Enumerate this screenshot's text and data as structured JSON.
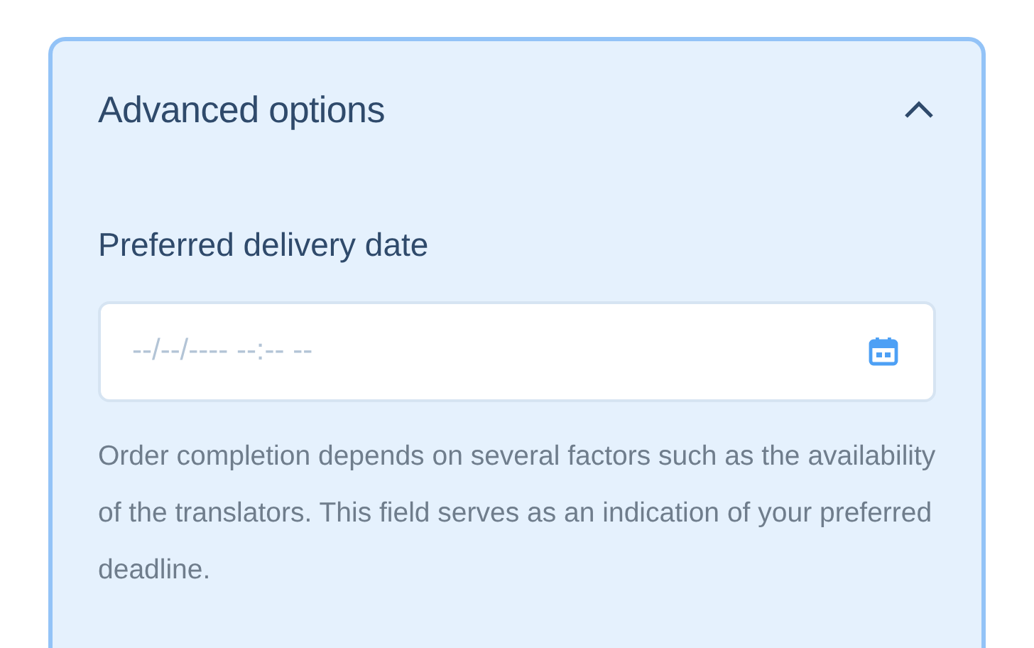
{
  "panel": {
    "title": "Advanced options",
    "expanded": true,
    "field": {
      "label": "Preferred delivery date",
      "placeholder": "--/--/---- --:-- --"
    },
    "help": "Order completion depends on several factors such as the availability of the translators. This field serves as an indication of your preferred deadline."
  }
}
